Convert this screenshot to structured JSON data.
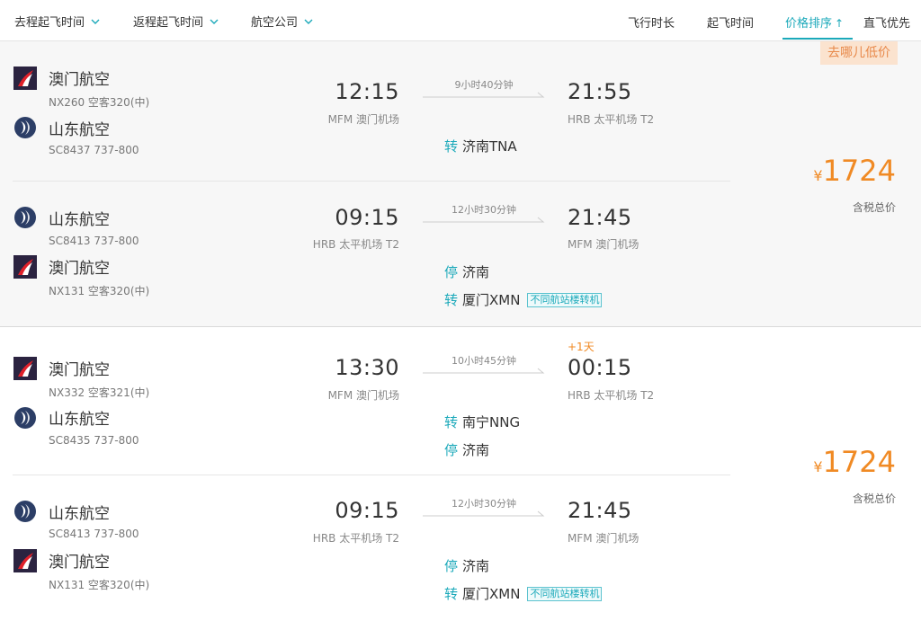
{
  "filters": {
    "depart_time": "去程起飞时间",
    "return_time": "返程起飞时间",
    "airline": "航空公司"
  },
  "sort": {
    "duration": "飞行时长",
    "takeoff": "起飞时间",
    "price": "价格排序",
    "price_arrow": "↑",
    "direct": "直飞优先"
  },
  "colors": {
    "accent": "#1ba9ba",
    "price": "#f08a24",
    "badge_bg": "#fbe3cf"
  },
  "offers": [
    {
      "badge": "去哪儿低价",
      "currency": "¥",
      "price": "1724",
      "price_note": "含税总价",
      "segments": [
        {
          "airlines": [
            {
              "name": "澳门航空",
              "flight": "NX260 空客320(中)",
              "logo": "air-macau-logo"
            },
            {
              "name": "山东航空",
              "flight": "SC8437 737-800",
              "logo": "shandong-airlines-logo"
            }
          ],
          "dep_time": "12:15",
          "dep_airport": "MFM 澳门机场",
          "duration": "9小时40分钟",
          "arr_time": "21:55",
          "arr_airport": "HRB 太平机场 T2",
          "stops": [
            {
              "tag": "转",
              "place": "济南TNA",
              "note": ""
            }
          ]
        },
        {
          "airlines": [
            {
              "name": "山东航空",
              "flight": "SC8413 737-800",
              "logo": "shandong-airlines-logo"
            },
            {
              "name": "澳门航空",
              "flight": "NX131 空客320(中)",
              "logo": "air-macau-logo"
            }
          ],
          "dep_time": "09:15",
          "dep_airport": "HRB 太平机场 T2",
          "duration": "12小时30分钟",
          "arr_time": "21:45",
          "arr_airport": "MFM 澳门机场",
          "stops": [
            {
              "tag": "停",
              "place": "济南",
              "note": ""
            },
            {
              "tag": "转",
              "place": "厦门XMN",
              "note": "不同航站楼转机"
            }
          ]
        }
      ]
    },
    {
      "currency": "¥",
      "price": "1724",
      "price_note": "含税总价",
      "segments": [
        {
          "airlines": [
            {
              "name": "澳门航空",
              "flight": "NX332 空客321(中)",
              "logo": "air-macau-logo"
            },
            {
              "name": "山东航空",
              "flight": "SC8435 737-800",
              "logo": "shandong-airlines-logo"
            }
          ],
          "dep_time": "13:30",
          "dep_airport": "MFM 澳门机场",
          "duration": "10小时45分钟",
          "arr_time": "00:15",
          "arr_airport": "HRB 太平机场 T2",
          "plus_day": "+1天",
          "stops": [
            {
              "tag": "转",
              "place": "南宁NNG",
              "note": ""
            },
            {
              "tag": "停",
              "place": "济南",
              "note": ""
            }
          ]
        },
        {
          "airlines": [
            {
              "name": "山东航空",
              "flight": "SC8413 737-800",
              "logo": "shandong-airlines-logo"
            },
            {
              "name": "澳门航空",
              "flight": "NX131 空客320(中)",
              "logo": "air-macau-logo"
            }
          ],
          "dep_time": "09:15",
          "dep_airport": "HRB 太平机场 T2",
          "duration": "12小时30分钟",
          "arr_time": "21:45",
          "arr_airport": "MFM 澳门机场",
          "stops": [
            {
              "tag": "停",
              "place": "济南",
              "note": ""
            },
            {
              "tag": "转",
              "place": "厦门XMN",
              "note": "不同航站楼转机"
            }
          ]
        }
      ]
    }
  ]
}
